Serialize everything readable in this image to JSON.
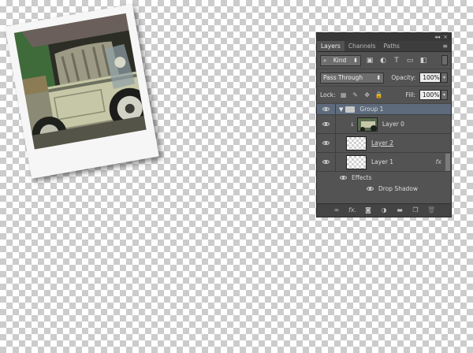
{
  "panel": {
    "tabs": [
      {
        "label": "Layers",
        "active": true
      },
      {
        "label": "Channels",
        "active": false
      },
      {
        "label": "Paths",
        "active": false
      }
    ],
    "topbar": {
      "collapse_glyph": "◂◂",
      "close_glyph": "×"
    },
    "tab_menu_glyph": "≡",
    "filter": {
      "kind_label": "Kind",
      "search_glyph": "⌕",
      "arrows_glyph": "⬍"
    },
    "filter_icons": [
      "image-filter-icon",
      "adjustment-filter-icon",
      "type-filter-icon",
      "shape-filter-icon",
      "smart-object-filter-icon"
    ],
    "blend_mode": "Pass Through",
    "opacity_label": "Opacity:",
    "opacity_value": "100%",
    "lock_label": "Lock:",
    "fill_label": "Fill:",
    "fill_value": "100%",
    "layers": {
      "group": {
        "name": "Group 1",
        "expanded": true
      },
      "layer0": {
        "name": "Layer 0",
        "clipped": true
      },
      "layer2": {
        "name": "Layer 2"
      },
      "layer1": {
        "name": "Layer 1",
        "fx": "fx"
      },
      "effects_label": "Effects",
      "drop_shadow_label": "Drop Shadow"
    },
    "bottom_icons": [
      "link-icon",
      "fx-icon",
      "mask-icon",
      "adjustment-icon",
      "folder-icon",
      "new-layer-icon",
      "trash-icon"
    ],
    "bottom_fx_text": "fx."
  },
  "colors": {
    "panel_bg": "#535353",
    "selected_row": "#5e6b7d"
  }
}
